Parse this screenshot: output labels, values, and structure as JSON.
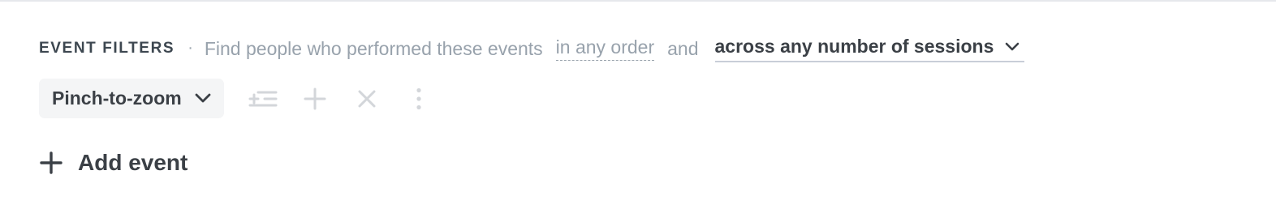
{
  "filters": {
    "title": "EVENT FILTERS",
    "separator": "·",
    "description": "Find people who performed these events",
    "order_value": "in any order",
    "conjunction": "and",
    "session_value": "across any number of sessions"
  },
  "event": {
    "selected": "Pinch-to-zoom",
    "tools": [
      {
        "icon": "filter-list-add-icon"
      },
      {
        "icon": "plus-icon"
      },
      {
        "icon": "close-icon"
      },
      {
        "icon": "more-vertical-icon"
      }
    ]
  },
  "add_event": {
    "label": "Add event"
  },
  "colors": {
    "text_dark": "#3b4046",
    "text_muted": "#98a2ac",
    "icon_disabled": "#d3d6da",
    "pill_bg": "#f4f5f6",
    "underline": "#c9ced8"
  }
}
